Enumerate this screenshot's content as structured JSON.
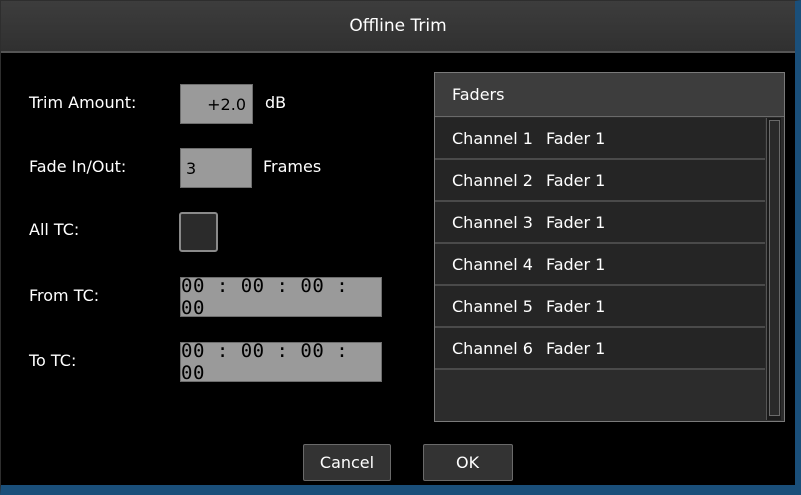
{
  "window": {
    "title": "Offline Trim"
  },
  "form": {
    "trim_label": "Trim Amount:",
    "trim_value": "+2.0",
    "trim_unit": "dB",
    "fade_label": "Fade In/Out:",
    "fade_value": "3",
    "fade_unit": "Frames",
    "all_tc_label": "All TC:",
    "all_tc_checked": false,
    "from_tc_label": "From TC:",
    "from_tc_value": "00 : 00 : 00 : 00",
    "to_tc_label": "To TC:",
    "to_tc_value": "00 : 00 : 00 : 00"
  },
  "faders_list": {
    "header": "Faders",
    "items": [
      {
        "channel": "Channel 1",
        "fader": "Fader 1"
      },
      {
        "channel": "Channel 2",
        "fader": "Fader 1"
      },
      {
        "channel": "Channel 3",
        "fader": "Fader 1"
      },
      {
        "channel": "Channel 4",
        "fader": "Fader 1"
      },
      {
        "channel": "Channel 5",
        "fader": "Fader 1"
      },
      {
        "channel": "Channel 6",
        "fader": "Fader 1"
      }
    ]
  },
  "buttons": {
    "cancel": "Cancel",
    "ok": "OK"
  },
  "colors": {
    "background": "#000000",
    "titlebar": "#333333",
    "field": "#9a9a9a",
    "window_border": "#1a4f7a"
  }
}
